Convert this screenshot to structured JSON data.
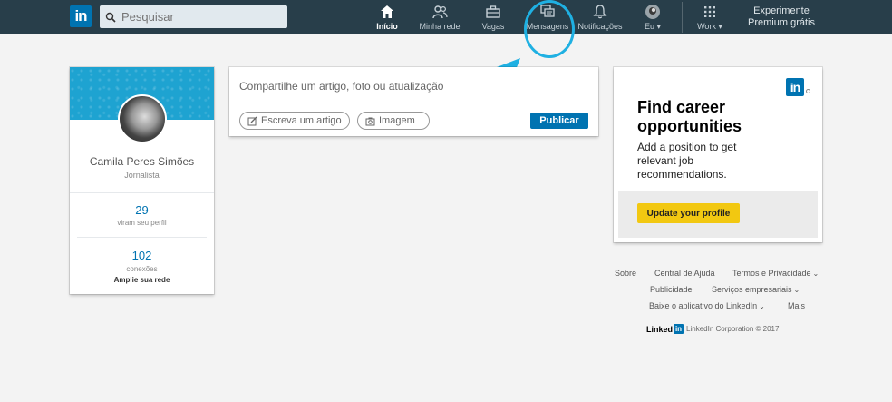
{
  "nav": {
    "logo": "in",
    "search_placeholder": "Pesquisar",
    "items": [
      {
        "label": "Início",
        "icon": "home-icon"
      },
      {
        "label": "Minha rede",
        "icon": "network-icon"
      },
      {
        "label": "Vagas",
        "icon": "briefcase-icon"
      },
      {
        "label": "Mensagens",
        "icon": "messages-icon"
      },
      {
        "label": "Notificações",
        "icon": "bell-icon"
      },
      {
        "label": "Eu",
        "icon": "avatar-icon"
      },
      {
        "label": "Work",
        "icon": "grid-icon"
      }
    ],
    "premium_line1": "Experimente",
    "premium_line2": "Premium grátis"
  },
  "profile": {
    "name": "Camila Peres Simões",
    "title": "Jornalista",
    "views_count": "29",
    "views_label": "viram seu perfil",
    "connections_count": "102",
    "connections_label": "conexões",
    "grow_network": "Amplie sua rede"
  },
  "share": {
    "placeholder": "Compartilhe um artigo, foto ou atualização",
    "write_article": "Escreva um artigo",
    "image": "Imagem",
    "publish": "Publicar"
  },
  "ad": {
    "logo": "in",
    "title": "Find career opportunities",
    "text": "Add a position to get relevant job recommendations.",
    "button": "Update your profile"
  },
  "footer": {
    "about": "Sobre",
    "help": "Central de Ajuda",
    "privacy": "Termos e Privacidade",
    "advertising": "Publicidade",
    "business": "Serviços empresariais",
    "app": "Baixe o aplicativo do LinkedIn",
    "more": "Mais",
    "brand": "Linked",
    "brand_in": "in",
    "copyright": "LinkedIn Corporation © 2017"
  },
  "colors": {
    "nav_bg": "#283e4a",
    "brand_blue": "#0073b1",
    "highlight": "#1fb0e2",
    "cta_yellow": "#f2c811"
  }
}
